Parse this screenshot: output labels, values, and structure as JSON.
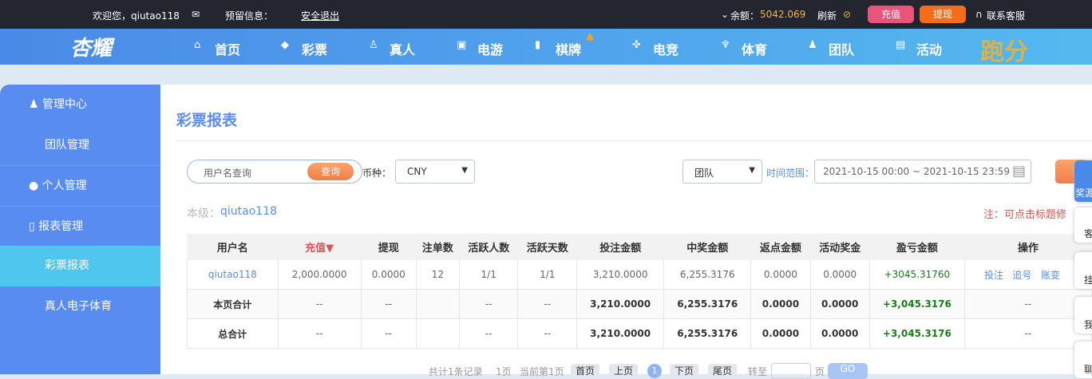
{
  "topbar": {
    "welcome": "欢迎您，qiutao118",
    "reserved": "预留信息：",
    "logout": "安全退出",
    "balance_label": "余额：",
    "balance": "5042.069",
    "refresh": "刷新",
    "recharge": "充值",
    "withdraw": "提现",
    "support": "联系客服"
  },
  "nav": {
    "logo": "杏耀",
    "items": [
      "首页",
      "彩票",
      "真人",
      "电游",
      "棋牌",
      "电竞",
      "体育",
      "团队",
      "活动"
    ],
    "promo": "跑分"
  },
  "sidebar": {
    "items": [
      "管理中心",
      "团队管理",
      "个人管理",
      "报表管理",
      "彩票报表",
      "真人电子体育"
    ],
    "active": "彩票报表"
  },
  "page": {
    "title": "彩票报表",
    "search_placeholder": "用户名查询",
    "search_button": "查询",
    "currency_label": "币种：",
    "currency": "CNY",
    "scope": "团队",
    "time_label": "时间范围：",
    "time_range": "2021-10-15 00:00 ~ 2021-10-15 23:59",
    "level_label": "本级：",
    "level_user": "qiutao118",
    "note": "注：可点击标题修"
  },
  "table": {
    "headers": [
      "用户名",
      "充值▼",
      "提现",
      "注单数",
      "活跃人数",
      "活跃天数",
      "投注金额",
      "中奖金额",
      "返点金额",
      "活动奖金",
      "盈亏金额",
      "操作"
    ],
    "row": [
      "qiutao118",
      "2,000.0000",
      "0.0000",
      "12",
      "1/1",
      "1/1",
      "3,210.0000",
      "6,255.3176",
      "0.0000",
      "0.0000",
      "+3045.31760"
    ],
    "actions": [
      "投注",
      "追号",
      "账变"
    ],
    "page_total": [
      "本页合计",
      "--",
      "--",
      "",
      "--",
      "--",
      "3,210.0000",
      "6,255.3176",
      "0.0000",
      "0.0000",
      "+3,045.3176",
      "--"
    ],
    "grand_total": [
      "总合计",
      "--",
      "--",
      "",
      "--",
      "--",
      "3,210.0000",
      "6,255.3176",
      "0.0000",
      "0.0000",
      "+3,045.3176",
      "--"
    ]
  },
  "pagination": {
    "total": "共计1条记录",
    "pages": "1页",
    "current": "当前第1页",
    "first": "首页",
    "prev": "上页",
    "page": "1",
    "next": "下页",
    "last": "尾页",
    "goto": "转至",
    "unit": "页",
    "go": "GO"
  },
  "float": [
    "奖源",
    "客",
    "挂",
    "我",
    "聊"
  ],
  "colors": {
    "accent": "#598cf0",
    "recharge": "#e9557a",
    "withdraw": "#f56d1b",
    "profit": "#1a7d1a",
    "note": "#e84f4f"
  }
}
